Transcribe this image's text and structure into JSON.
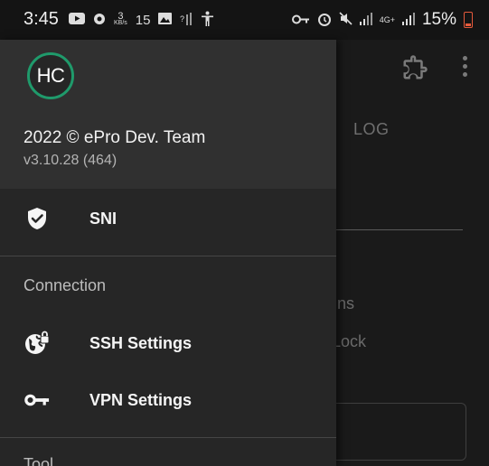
{
  "status_bar": {
    "time": "3:45",
    "data_speed_value": "3",
    "data_speed_unit": "KB/s",
    "notification_count": "15",
    "network_label": "4G+",
    "battery_percent": "15%"
  },
  "drawer": {
    "avatar_initials": "HC",
    "copyright": "2022 © ePro Dev. Team",
    "version": "v3.10.28 (464)",
    "items": [
      {
        "label": "SNI",
        "icon": "shield-check-icon"
      },
      {
        "label": "SSH Settings",
        "icon": "globe-lock-icon"
      },
      {
        "label": "VPN Settings",
        "icon": "key-icon"
      }
    ],
    "sections": {
      "connection": "Connection",
      "tool": "Tool"
    }
  },
  "background": {
    "tab_log": "LOG",
    "text_ns": "ns",
    "text_lock": "Lock"
  }
}
